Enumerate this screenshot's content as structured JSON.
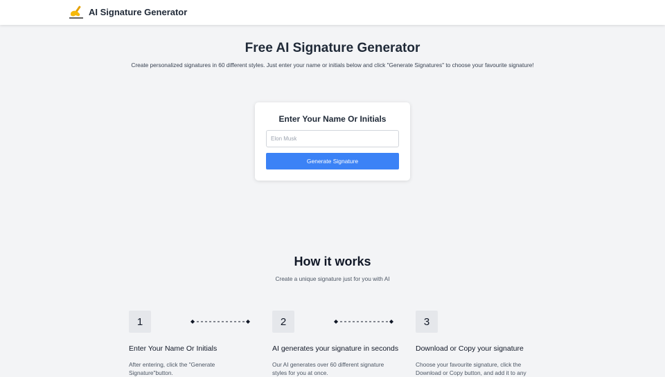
{
  "header": {
    "logo_icon": "writing-hand-icon",
    "app_title": "AI Signature Generator"
  },
  "hero": {
    "title": "Free AI Signature Generator",
    "subtitle": "Create personalized signatures in 60 different styles. Just enter your name or initials below and click \"Generate Signatures\" to choose your favourite signature!"
  },
  "form": {
    "title": "Enter Your Name Or Initials",
    "input_placeholder": "Elon Musk",
    "input_value": "",
    "button_label": "Generate Signature"
  },
  "how_it_works": {
    "title": "How it works",
    "subtitle": "Create a unique signature just for you with AI",
    "steps": [
      {
        "number": "1",
        "title": "Enter Your Name Or Initials",
        "description": "After entering, click the \"Generate Signature\"button."
      },
      {
        "number": "2",
        "title": "AI generates your signature in seconds",
        "description": "Our AI generates over 60 different signature styles for you at once."
      },
      {
        "number": "3",
        "title": "Download or Copy your signature",
        "description": "Choose your favourite signature, click the Download or Copy button, and add it to any"
      }
    ]
  },
  "colors": {
    "accent": "#3b82f6",
    "background": "#f3f4f6",
    "card": "#ffffff"
  }
}
